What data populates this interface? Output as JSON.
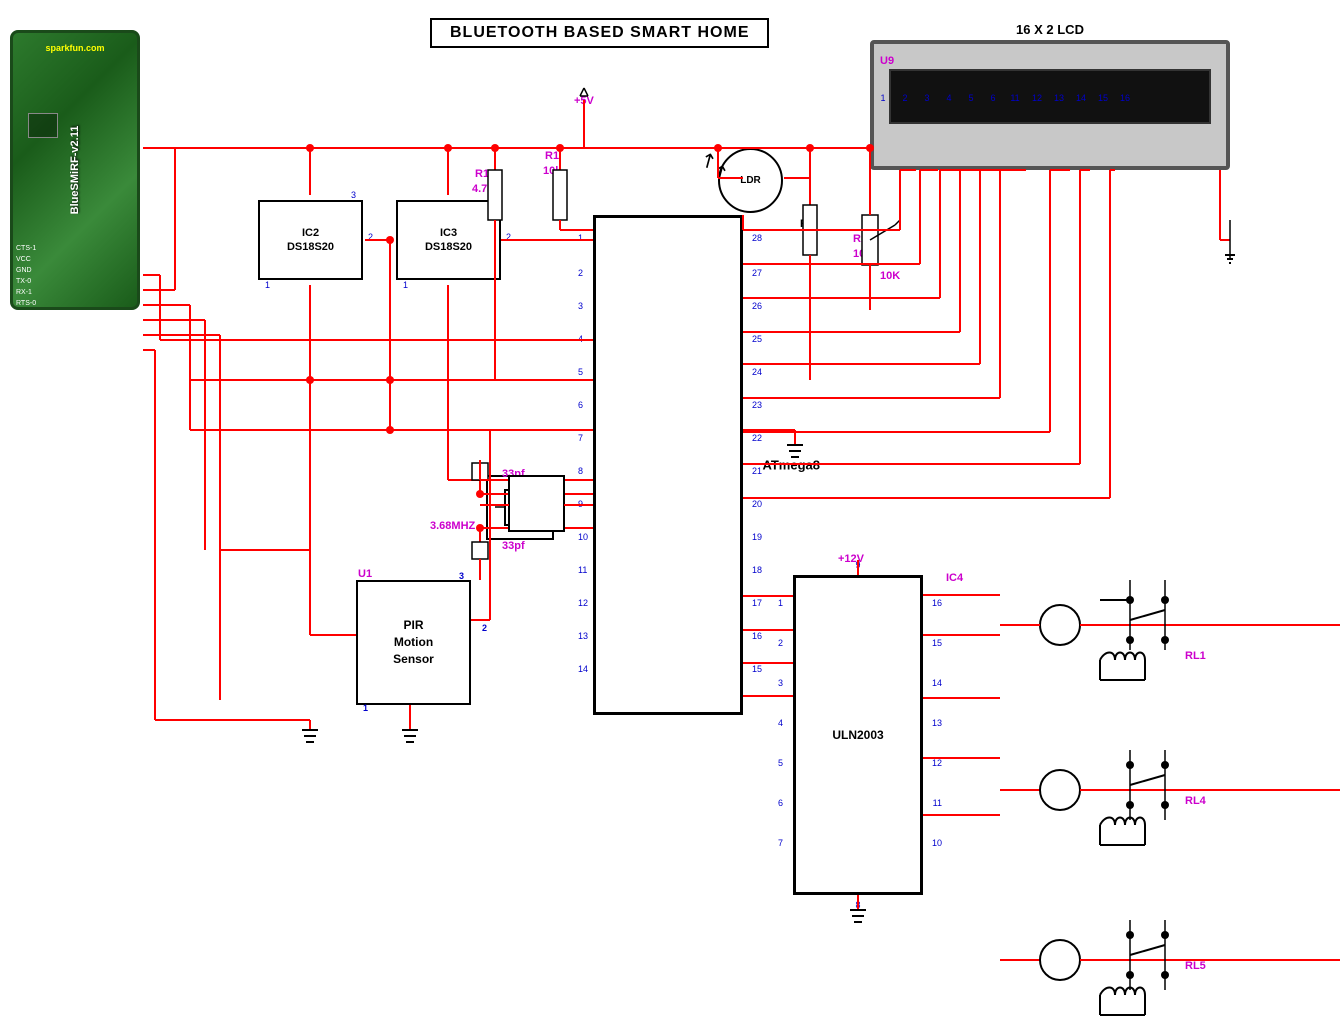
{
  "title": "BLUETOOTH BASED SMART HOME",
  "lcd_title": "16 X 2 LCD",
  "lcd_u": "U9",
  "ic2_label": "IC2\nDS18S20",
  "ic3_label": "IC3\nDS18S20",
  "atmega_label": "ATmega8",
  "uln_label": "ULN2003",
  "pir_label": "PIR\nMotion\nSensor",
  "pir_u": "U1",
  "ic4_label": "IC4",
  "ldr_label": "LDR",
  "crystal_freq": "3.68MHZ",
  "cap1": "33pf",
  "cap2": "33pf",
  "r10_label": "R10",
  "r10_val": "4.7k",
  "r1_label": "R1",
  "r1_val": "10k",
  "r2_label": "R2",
  "r2_val": "10k",
  "r3_val": "10K",
  "vcc5": "+5V",
  "vcc12": "+12V",
  "rl1": "RL1",
  "rl4": "RL4",
  "rl5": "RL5",
  "bt_name": "BlueSMiRF-v2.11",
  "bt_site": "sparkfun.com",
  "lcd_pins": [
    "1",
    "2",
    "3",
    "4",
    "5",
    "6",
    "11",
    "12",
    "13",
    "14",
    "15",
    "16"
  ]
}
